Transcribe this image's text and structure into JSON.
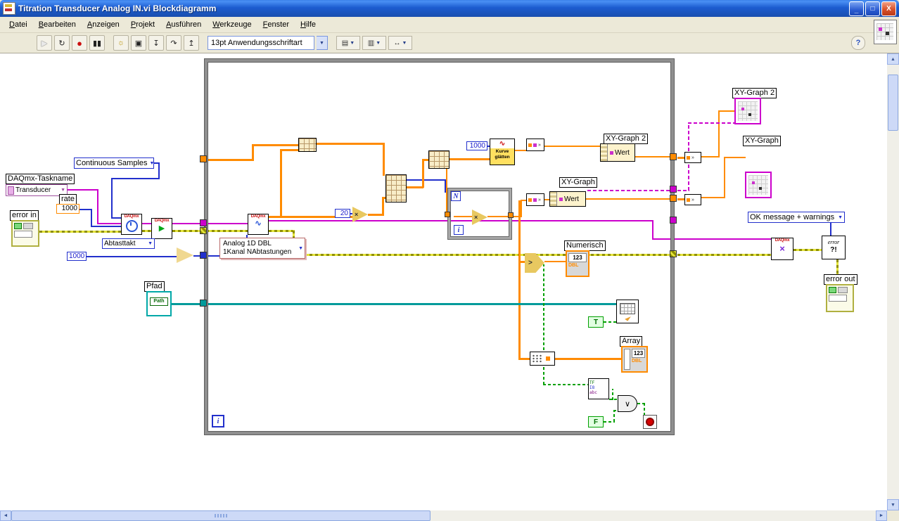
{
  "window": {
    "title": "Titration Transducer Analog IN.vi Blockdiagramm",
    "minimize": "_",
    "maximize": "□",
    "close": "X"
  },
  "menu": {
    "items": [
      "Datei",
      "Bearbeiten",
      "Anzeigen",
      "Projekt",
      "Ausführen",
      "Werkzeuge",
      "Fenster",
      "Hilfe"
    ]
  },
  "toolbar": {
    "run": "▶",
    "run_continuous": "↻",
    "abort": "●",
    "pause": "▮▮",
    "highlight": "☼",
    "retain": "▣",
    "step_into": "↧",
    "step_over": "↷",
    "step_out": "↥",
    "font_selector": "13pt Anwendungsschriftart",
    "align": "▤",
    "distribute": "▥",
    "resize": "↔",
    "help": "?"
  },
  "ui": {
    "arrow": "▼",
    "up": "▲",
    "down": "▼",
    "left": "◄",
    "right": "►"
  },
  "diagram": {
    "enum_continuous": "Continuous Samples",
    "lbl_taskname": "DAQmx-Taskname",
    "io_transducer": "Transducer",
    "lbl_rate": "rate",
    "rate_value": "1000",
    "lbl_error_in": "error in",
    "ring_abtasttakt": "Abtasttakt",
    "samples_value": "1000",
    "daqmx": "DAQmx",
    "analog_line1": "Analog 1D DBL",
    "analog_line2": "1Kanal NAbtastungen",
    "lbl_pfad": "Pfad",
    "path_glyph": "Path",
    "const_20": "20",
    "points_value": "1000",
    "kurve_line1": "Kurve",
    "kurve_line2": "glätten",
    "for_count": "N",
    "iter": "i",
    "lbl_xy_graph": "XY-Graph",
    "lbl_xy_graph2": "XY-Graph 2",
    "prop_wert": "Wert",
    "lbl_numerisch": "Numerisch",
    "num_glyph": "123",
    "dbl": "DBL",
    "lbl_array": "Array",
    "bool_true": "T",
    "bool_false": "F",
    "greater": ">",
    "multiply": "×",
    "or_glyph": "∨",
    "conv_tf": "TF",
    "conv_i8": "I8",
    "conv_abc": "abc",
    "enum_ok": "OK message + warnings",
    "err_glyph1": "error",
    "err_glyph2": "?!",
    "lbl_error_out": "error out"
  }
}
